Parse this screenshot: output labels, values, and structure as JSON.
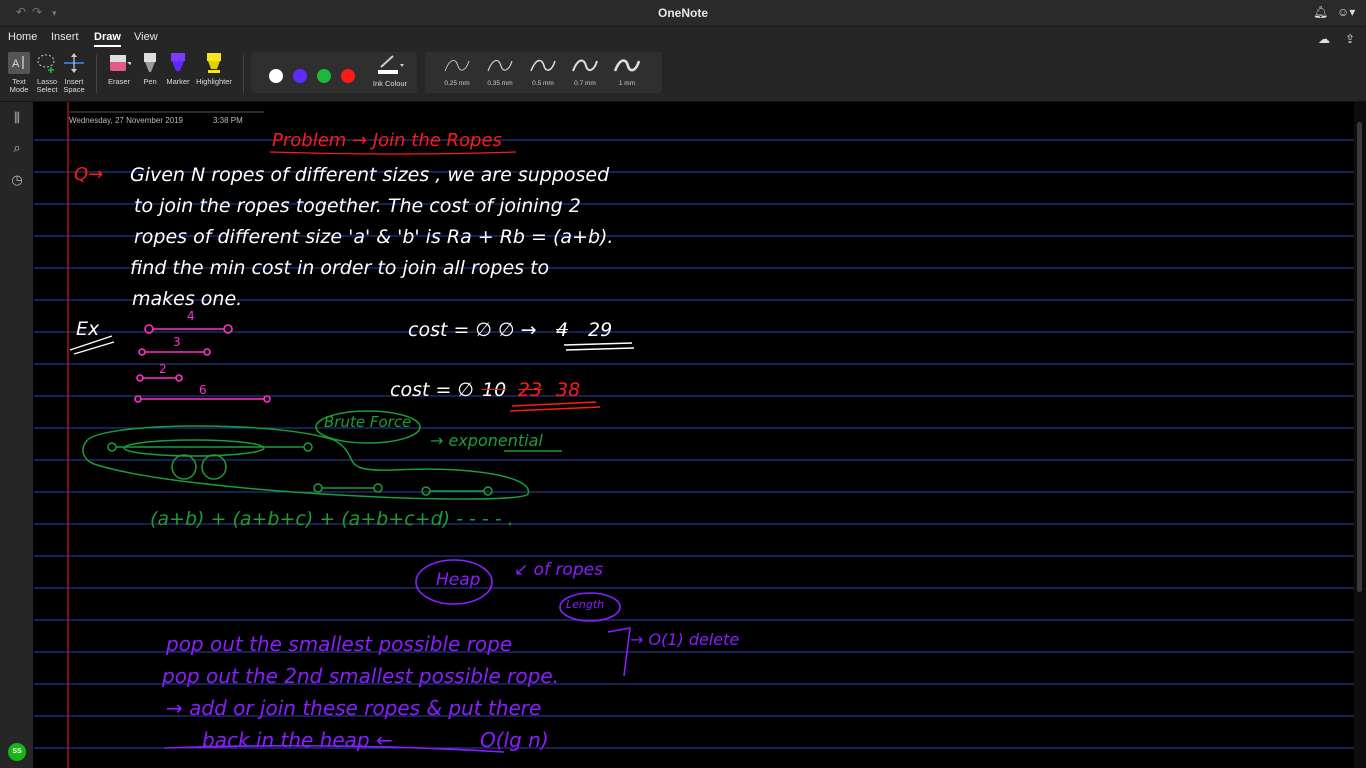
{
  "window": {
    "title": "OneNote"
  },
  "menu": [
    "Home",
    "Insert",
    "Draw",
    "View"
  ],
  "active_menu": "Draw",
  "ribbon": {
    "tools": [
      {
        "name": "text-mode",
        "label": "Text Mode",
        "icon": "text-cursor-icon"
      },
      {
        "name": "lasso-select",
        "label": "Lasso Select",
        "icon": "lasso-icon"
      },
      {
        "name": "insert-space",
        "label": "Insert Space",
        "icon": "insert-space-icon"
      },
      {
        "name": "eraser",
        "label": "Eraser",
        "icon": "eraser-icon"
      },
      {
        "name": "pen",
        "label": "Pen",
        "icon": "pen-icon"
      },
      {
        "name": "marker",
        "label": "Marker",
        "icon": "marker-icon"
      },
      {
        "name": "highlighter",
        "label": "Highlighter",
        "icon": "highlighter-icon"
      }
    ],
    "colors": [
      "#ffffff",
      "#5b2bff",
      "#1bb83a",
      "#ff1a1a"
    ],
    "ink_colour_label": "Ink Colour",
    "pen_sizes": [
      "0.25 mm",
      "0.35 mm",
      "0.5 mm",
      "0.7 mm",
      "1 mm"
    ]
  },
  "page": {
    "date": "Wednesday, 27 November 2019",
    "time": "3:38 PM"
  },
  "notes": {
    "title": "Problem → Join the Ropes",
    "q_marker": "Q→",
    "line1": "Given N ropes of different sizes , we are supposed",
    "line2": "to join the ropes together. The cost of joining 2",
    "line3": "ropes of different size 'a' & 'b' is Ra + Rb = (a+b).",
    "line4": "find the min cost in order to join all ropes to",
    "line5": "makes one.",
    "ex": "Ex",
    "rope_labels": [
      "4",
      "3",
      "2",
      "6"
    ],
    "cost1": "cost = ∅  ∅ →",
    "cost1_struck": "4",
    "cost1_final": "29",
    "cost2": "cost = ∅",
    "cost2_a": "10",
    "cost2_b": "23",
    "cost2_final": "38",
    "brute": "Brute Force",
    "exponential": "→ exponential",
    "combo": "(a+b) + (a+b+c) + (a+b+c+d) - - - - .",
    "heap": "Heap",
    "of_ropes": "↙ of ropes",
    "lengths": "Length",
    "pop1": "pop out the smallest possible rope",
    "pop2": "pop out the 2nd smallest possible rope.",
    "add": "→ add or join these ropes & put there",
    "back": "back in the heap ←",
    "ologn1": "→ O(1) delete",
    "ologn2": "O(lg n)"
  },
  "user": {
    "initials": "SS"
  }
}
